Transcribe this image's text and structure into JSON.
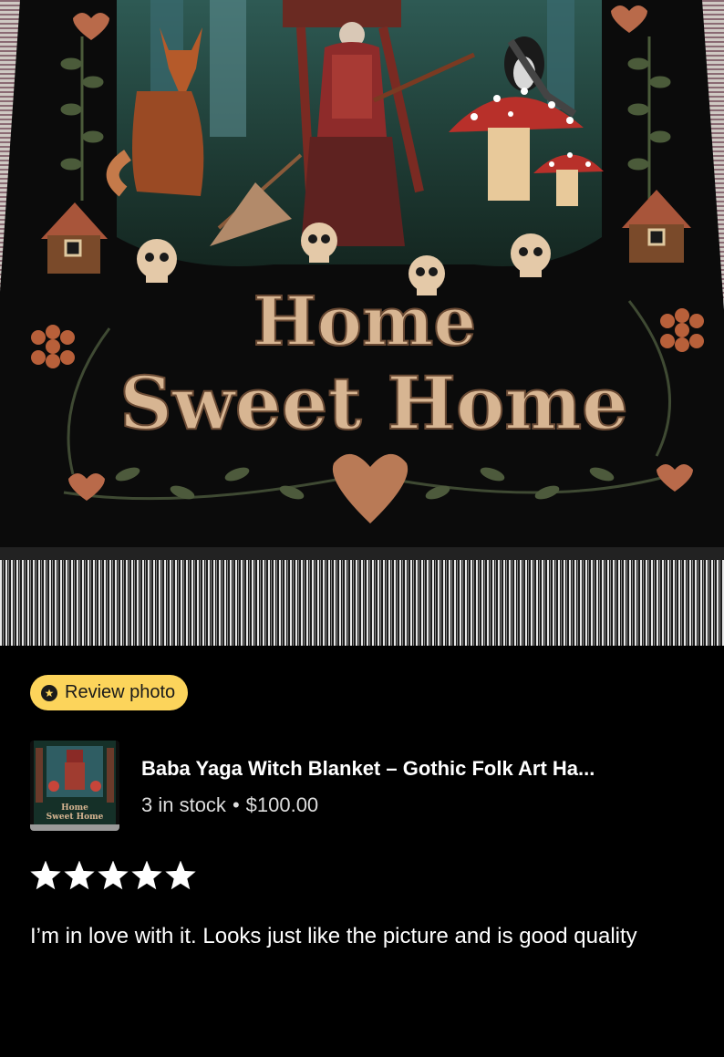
{
  "photo": {
    "blanket_text_line1": "Home",
    "blanket_text_line2": "Sweet Home"
  },
  "badge": {
    "label": "Review photo",
    "icon": "review-photo-icon",
    "color": "#fcd45b"
  },
  "item": {
    "title": "Baba Yaga Witch Blanket – Gothic Folk Art Ha...",
    "stock": "3 in stock",
    "separator": "•",
    "price": "$100.00",
    "thumb_text_line1": "Home",
    "thumb_text_line2": "Sweet Home"
  },
  "rating": {
    "stars": 5,
    "max": 5,
    "color": "#ffffff"
  },
  "review": {
    "text": "I’m in love with it. Looks just like the picture and is good quality"
  }
}
